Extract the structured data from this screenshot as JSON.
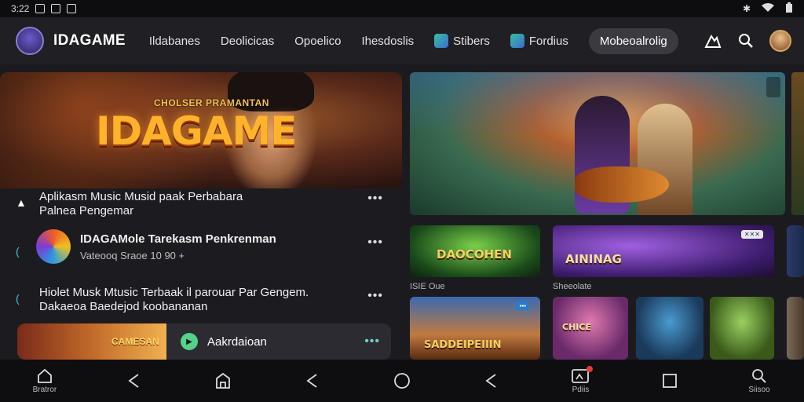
{
  "status": {
    "time": "3:22"
  },
  "header": {
    "brand": "IDAGAME",
    "nav": [
      {
        "label": "Ildabanes"
      },
      {
        "label": "Deolicicas"
      },
      {
        "label": "Opoelico"
      },
      {
        "label": "Ihesdoslis"
      },
      {
        "label": "Stibers"
      },
      {
        "label": "Fordius"
      }
    ],
    "pill": "Mobeoalrolig"
  },
  "hero": {
    "subtitle": "CHOLSER PRAMANTAN",
    "title": "IDAGAME"
  },
  "feed": {
    "item1": {
      "line1": "Aplikasm Music Musid paak Perbabara",
      "line2": "Palnea Pengemar"
    },
    "item2": {
      "title": "IDAGAMole Tarekasm Penkrenman",
      "meta": "Vateooq Sraoe 10 90 +"
    },
    "item3": {
      "line1": "Hiolet Musk Mtusic Terbaak il parouar Par Gengem.",
      "line2": "Dakaeoa Baedejod koobananan"
    },
    "card": {
      "thumb_label": "CAMESAN",
      "label": "Aakrdaioan"
    }
  },
  "tiles": {
    "dragon": "DAOCOHEN",
    "purple": "AININAG",
    "caption_left": "ISIE Oue",
    "caption_right": "Sheeolate",
    "orange": "SADDEIPEIIIN",
    "pink": "CHICE"
  },
  "bottom": [
    {
      "label": "Bratror"
    },
    {
      "label": ""
    },
    {
      "label": ""
    },
    {
      "label": ""
    },
    {
      "label": ""
    },
    {
      "label": ""
    },
    {
      "label": "Pdiis"
    },
    {
      "label": ""
    },
    {
      "label": "Siisoo"
    }
  ],
  "colors": {
    "accent": "#ffb22a",
    "notify": "#e53935",
    "play": "#54d18a"
  }
}
